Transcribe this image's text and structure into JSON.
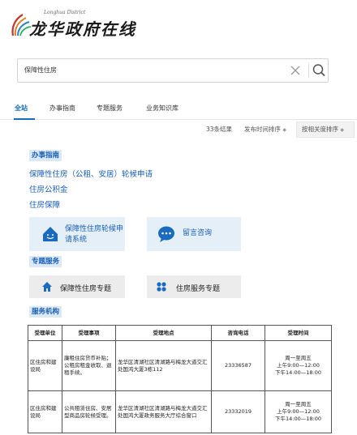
{
  "header": {
    "site_title": "龙华政府在线",
    "site_subtitle": "Longhua District"
  },
  "search": {
    "query": "保障性住房"
  },
  "tabs": [
    {
      "label": "全站"
    },
    {
      "label": "办事指南"
    },
    {
      "label": "专题服务"
    },
    {
      "label": "业务知识库"
    }
  ],
  "sort": {
    "result_count": "33条结果",
    "by_time": "发布时间排序",
    "by_relevance": "按相关度排序"
  },
  "guide": {
    "heading": "办事指南",
    "links": [
      "保障性住房（公租、安居）轮候申请",
      "住房公积金",
      "住房保障"
    ],
    "cards": [
      {
        "label": "保障性住房轮候申请系统"
      },
      {
        "label": "留言咨询"
      }
    ]
  },
  "topics": {
    "heading": "专题服务",
    "buttons": [
      {
        "label": "保障性住房专题"
      },
      {
        "label": "住房服务专题"
      }
    ]
  },
  "agencies": {
    "heading": "服务机构",
    "columns": [
      "受理单位",
      "受理事项",
      "受理地点",
      "咨询电话",
      "受理时间"
    ],
    "rows": [
      {
        "unit": "区住房和建设局",
        "matter": "廉租住房货币补贴；公租房租金收取、退租手续。",
        "place": "龙华区清湖社区清湖路与梅龙大道交汇处国鸿大厦3栋112",
        "phone": "23336587",
        "hours": [
          "周一至周五",
          "上午9:00—12:00",
          "下午14:00—18:00"
        ]
      },
      {
        "unit": "区住房和建设局",
        "matter": "公共租赁住房、安居型商品房轮候受理。",
        "place": "龙华区清湖社区清湖路与梅龙大道交汇处国鸿大厦政务服务大厅综合窗口",
        "phone": "23332019",
        "hours": [
          "周一至周五",
          "上午9:00—12:00",
          "下午14:00—18:00"
        ]
      }
    ]
  },
  "colors": {
    "accent": "#1a6bbf",
    "section_bg": "#dbe9f6",
    "card_bg": "#e4eff8",
    "button_bg": "#ececec"
  }
}
